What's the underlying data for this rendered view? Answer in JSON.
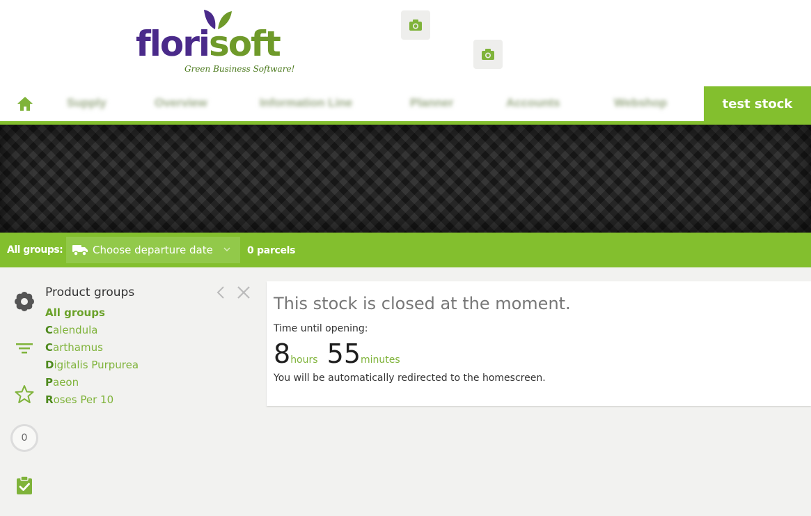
{
  "brand": {
    "logo_text_a": "flor",
    "logo_text_b": "i",
    "logo_text_c": "soft",
    "tagline": "Green Business Software!",
    "purple": "#4a2a8a",
    "green": "#83bf2e"
  },
  "header": {
    "camera_buttons": [
      "camera-icon",
      "camera-icon"
    ]
  },
  "nav": {
    "home_icon": "home-icon",
    "items": [
      "Supply",
      "Overview",
      "Information Line",
      "Planner",
      "Accounts",
      "Webshop"
    ],
    "active_label": "test stock"
  },
  "toolbar": {
    "groups_label": "All groups:",
    "departure_placeholder": "Choose departure date",
    "departure_icon": "truck-icon",
    "parcels": "0 parcels"
  },
  "sidebar": {
    "icons": [
      "flower-icon",
      "filter-icon",
      "star-icon",
      "cart-count",
      "clipboard-check-icon"
    ],
    "cart_count": "0"
  },
  "product_groups": {
    "title": "Product groups",
    "items": [
      {
        "initial": "",
        "rest": "All groups"
      },
      {
        "initial": "C",
        "rest": "alendula"
      },
      {
        "initial": "C",
        "rest": "arthamus"
      },
      {
        "initial": "D",
        "rest": "igitalis Purpurea"
      },
      {
        "initial": "P",
        "rest": "aeon"
      },
      {
        "initial": "R",
        "rest": "oses Per 10"
      }
    ]
  },
  "message": {
    "title": "This stock is closed at the moment.",
    "subtitle": "Time until opening:",
    "hours_value": "8",
    "hours_unit": "hours",
    "minutes_value": "55",
    "minutes_unit": "minutes",
    "redirect": "You will be automatically redirected to the homescreen."
  }
}
